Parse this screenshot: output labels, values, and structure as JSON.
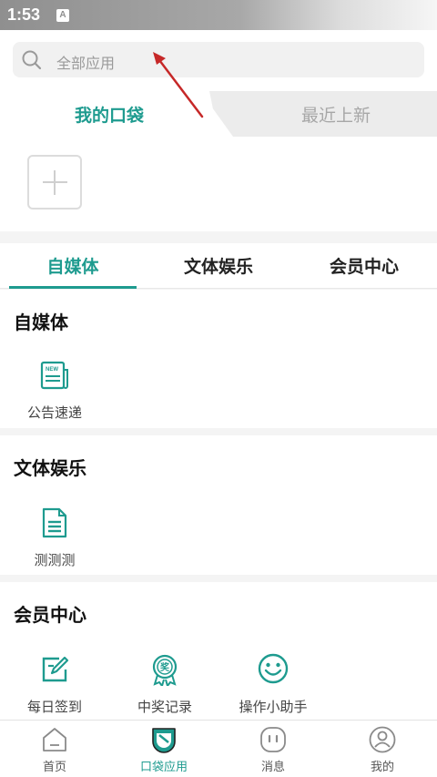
{
  "status_bar": {
    "time": "1:53",
    "notification_letter": "A"
  },
  "search": {
    "placeholder": "全部应用",
    "icon": "search-icon"
  },
  "pocket_tabs": {
    "active": "我的口袋",
    "inactive": "最近上新"
  },
  "category_tabs": [
    "自媒体",
    "文体娱乐",
    "会员中心"
  ],
  "sections": [
    {
      "title": "自媒体",
      "items": [
        {
          "label": "公告速递",
          "icon": "news-icon"
        }
      ]
    },
    {
      "title": "文体娱乐",
      "items": [
        {
          "label": "测测测",
          "icon": "document-icon"
        }
      ]
    },
    {
      "title": "会员中心",
      "items": [
        {
          "label": "每日签到",
          "icon": "sign-in-icon"
        },
        {
          "label": "中奖记录",
          "icon": "award-icon"
        },
        {
          "label": "操作小助手",
          "icon": "smiley-icon"
        }
      ]
    }
  ],
  "bottom_nav": [
    {
      "label": "首页",
      "icon": "home-icon"
    },
    {
      "label": "口袋应用",
      "icon": "pocket-icon",
      "active": true
    },
    {
      "label": "消息",
      "icon": "message-icon"
    },
    {
      "label": "我的",
      "icon": "profile-icon"
    }
  ],
  "colors": {
    "accent": "#1e9b8f",
    "annotation_arrow": "#c62828"
  }
}
